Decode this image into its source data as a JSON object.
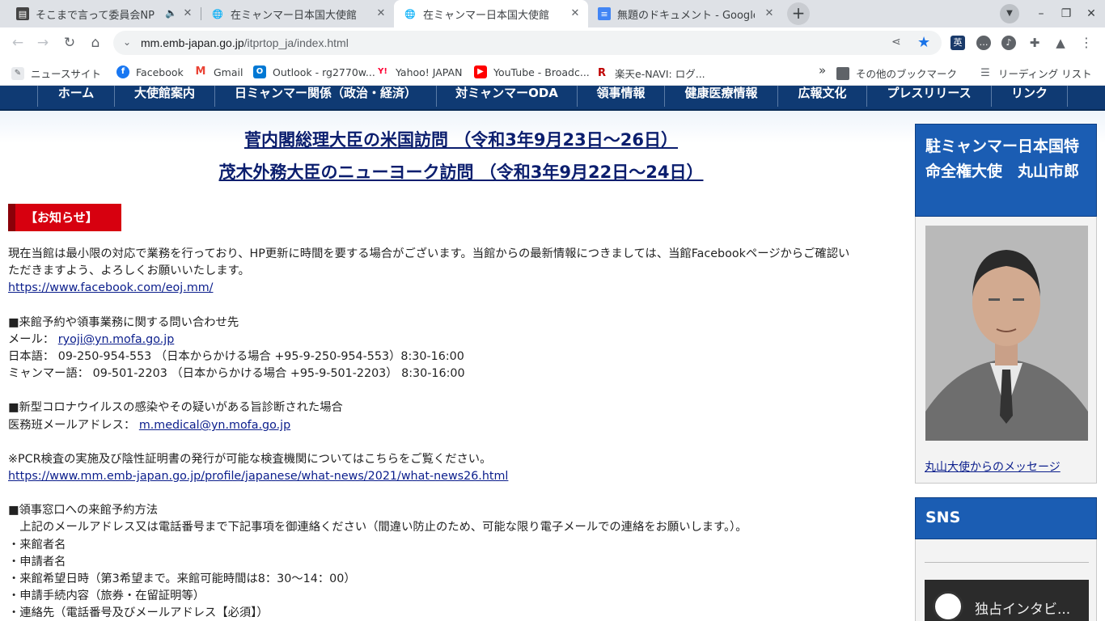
{
  "browser": {
    "tabs": [
      {
        "title": "そこまで言って委員会NP |",
        "muted": "🔈"
      },
      {
        "title": "在ミャンマー日本国大使館"
      },
      {
        "title": "在ミャンマー日本国大使館"
      },
      {
        "title": "無題のドキュメント - Google"
      }
    ],
    "close_glyph": "✕",
    "new_tab_glyph": "+",
    "url_host": "mm.emb-japan.go.jp",
    "url_path": "/itprtop_ja/index.html",
    "bookmarks": [
      {
        "label": "ニュースサイト",
        "icon": "note-icon",
        "color": "#5f6368"
      },
      {
        "label": "Facebook",
        "icon": "facebook-icon",
        "color": "#1877f2"
      },
      {
        "label": "Gmail",
        "icon": "gmail-icon",
        "color": "#ea4335"
      },
      {
        "label": "Outlook - rg2770w...",
        "icon": "outlook-icon",
        "color": "#0078d4"
      },
      {
        "label": "Yahoo! JAPAN",
        "icon": "yahoo-icon",
        "color": "#ff0033"
      },
      {
        "label": "YouTube - Broadc...",
        "icon": "youtube-icon",
        "color": "#ff0000"
      },
      {
        "label": "楽天e-NAVI: ログ...",
        "icon": "rakuten-icon",
        "color": "#bf0000"
      }
    ],
    "other_bookmarks": "その他のブックマーク",
    "reading_list": "リーディング リスト",
    "overflow": "»"
  },
  "site_nav": [
    "ホーム",
    "大使館案内",
    "日ミャンマー関係（政治・経済）",
    "対ミャンマーODA",
    "領事情報",
    "健康医療情報",
    "広報文化",
    "プレスリリース",
    "リンク"
  ],
  "headlines": [
    "菅内閣総理大臣の米国訪問 （令和3年9月23日～26日）",
    "茂木外務大臣のニューヨーク訪問 （令和3年9月22日～24日）"
  ],
  "notice_title": "【お知らせ】",
  "notice": {
    "intro1": "現在当館は最小限の対応で業務を行っており、HP更新に時間を要する場合がございます。当館からの最新情報につきましては、当館Facebookページからご確認い",
    "intro2": "ただきますよう、よろしくお願いいたします。",
    "facebook_url": "https://www.facebook.com/eoj.mm/",
    "contact_heading": "■来館予約や領事業務に関する問い合わせ先",
    "mail_label": "メール：",
    "mail": "ryoji@yn.mofa.go.jp",
    "jp_phone": "日本語： 09-250-954-553 （日本からかける場合 +95-9-250-954-553）8:30-16:00",
    "mm_phone": "ミャンマー語： 09-501-2203 （日本からかける場合 +95-9-501-2203） 8:30-16:00",
    "covid_heading": "■新型コロナウイルスの感染やその疑いがある旨診断された場合",
    "medical_label": "医務班メールアドレス：",
    "medical_mail": "m.medical@yn.mofa.go.jp",
    "pcr_text": "※PCR検査の実施及び陰性証明書の発行が可能な検査機関についてはこちらをご覧ください。",
    "pcr_url": "https://www.mm.emb-japan.go.jp/profile/japanese/what-news/2021/what-news26.html",
    "reserve_heading": "■領事窓口への来館予約方法",
    "reserve_intro": "　上記のメールアドレス又は電話番号まで下記事項を御連絡ください（間違い防止のため、可能な限り電子メールでの連絡をお願いします。）。",
    "items": [
      "・来館者名",
      "・申請者名",
      "・来館希望日時（第3希望まで。来館可能時間は8：30～14：00）",
      "・申請手続内容（旅券・在留証明等）",
      "・連絡先（電話番号及びメールアドレス【必須】）"
    ]
  },
  "sidebar": {
    "ambassador_title": "駐ミャンマー日本国特命全権大使　丸山市郎",
    "ambassador_message": "丸山大使からのメッセージ",
    "sns_title": "SNS",
    "video_title": "独占インタビ..."
  }
}
